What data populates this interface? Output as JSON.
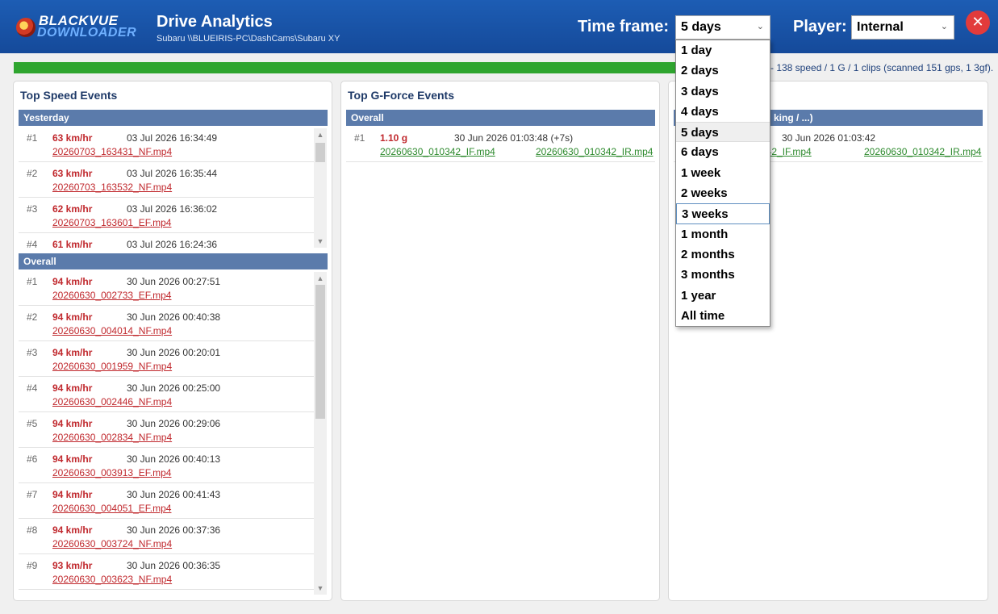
{
  "header": {
    "logo_line1": "BLACKVUE",
    "logo_line2": "DOWNLOADER",
    "title": "Drive Analytics",
    "subtitle": "Subaru    \\\\BLUEIRIS-PC\\DashCams\\Subaru XY",
    "timeframe_label": "Time frame:",
    "timeframe_value": "5 days",
    "player_label": "Player:",
    "player_value": "Internal",
    "close_glyph": "✕"
  },
  "status_text": "- 138 speed / 1 G / 1 clips (scanned 151 gps, 1 3gf).",
  "progress_fraction": 1.0,
  "speed_panel": {
    "title": "Top Speed Events",
    "yesterday_label": "Yesterday",
    "yesterday": [
      {
        "rank": "#1",
        "speed": "63 km/hr",
        "datetime": "03 Jul 2026 16:34:49",
        "file": "20260703_163431_NF.mp4"
      },
      {
        "rank": "#2",
        "speed": "63 km/hr",
        "datetime": "03 Jul 2026 16:35:44",
        "file": "20260703_163532_NF.mp4"
      },
      {
        "rank": "#3",
        "speed": "62 km/hr",
        "datetime": "03 Jul 2026 16:36:02",
        "file": "20260703_163601_EF.mp4"
      },
      {
        "rank": "#4",
        "speed": "61 km/hr",
        "datetime": "03 Jul 2026 16:24:36",
        "file": ""
      }
    ],
    "overall_label": "Overall",
    "overall": [
      {
        "rank": "#1",
        "speed": "94 km/hr",
        "datetime": "30 Jun 2026 00:27:51",
        "file": "20260630_002733_EF.mp4"
      },
      {
        "rank": "#2",
        "speed": "94 km/hr",
        "datetime": "30 Jun 2026 00:40:38",
        "file": "20260630_004014_NF.mp4"
      },
      {
        "rank": "#3",
        "speed": "94 km/hr",
        "datetime": "30 Jun 2026 00:20:01",
        "file": "20260630_001959_NF.mp4"
      },
      {
        "rank": "#4",
        "speed": "94 km/hr",
        "datetime": "30 Jun 2026 00:25:00",
        "file": "20260630_002446_NF.mp4"
      },
      {
        "rank": "#5",
        "speed": "94 km/hr",
        "datetime": "30 Jun 2026 00:29:06",
        "file": "20260630_002834_NF.mp4"
      },
      {
        "rank": "#6",
        "speed": "94 km/hr",
        "datetime": "30 Jun 2026 00:40:13",
        "file": "20260630_003913_EF.mp4"
      },
      {
        "rank": "#7",
        "speed": "94 km/hr",
        "datetime": "30 Jun 2026 00:41:43",
        "file": "20260630_004051_EF.mp4"
      },
      {
        "rank": "#8",
        "speed": "94 km/hr",
        "datetime": "30 Jun 2026 00:37:36",
        "file": "20260630_003724_NF.mp4"
      },
      {
        "rank": "#9",
        "speed": "93 km/hr",
        "datetime": "30 Jun 2026 00:36:35",
        "file": "20260630_003623_NF.mp4"
      }
    ]
  },
  "gforce_panel": {
    "title": "Top G-Force Events",
    "overall_label": "Overall",
    "events": [
      {
        "rank": "#1",
        "value": "1.10 g",
        "datetime": "30 Jun 2026 01:03:48  (+7s)",
        "file1": "20260630_010342_IF.mp4",
        "file2": "20260630_010342_IR.mp4"
      }
    ]
  },
  "third_panel": {
    "section_partial": "king / ...)",
    "events": [
      {
        "datetime": "30 Jun 2026 01:03:42",
        "file1": "342_IF.mp4",
        "file2": "20260630_010342_IR.mp4"
      }
    ]
  },
  "dropdown": {
    "options": [
      "1 day",
      "2 days",
      "3 days",
      "4 days",
      "5 days",
      "6 days",
      "1 week",
      "2 weeks",
      "3 weeks",
      "1 month",
      "2 months",
      "3 months",
      "1 year",
      "All time"
    ],
    "selected_index": 4,
    "hover_index": 8
  },
  "colors": {
    "header": "#1d5db4",
    "section": "#5b7bab",
    "speed_red": "#c0282d",
    "file_green": "#2d8a2d",
    "progress": "#2fa52f"
  }
}
